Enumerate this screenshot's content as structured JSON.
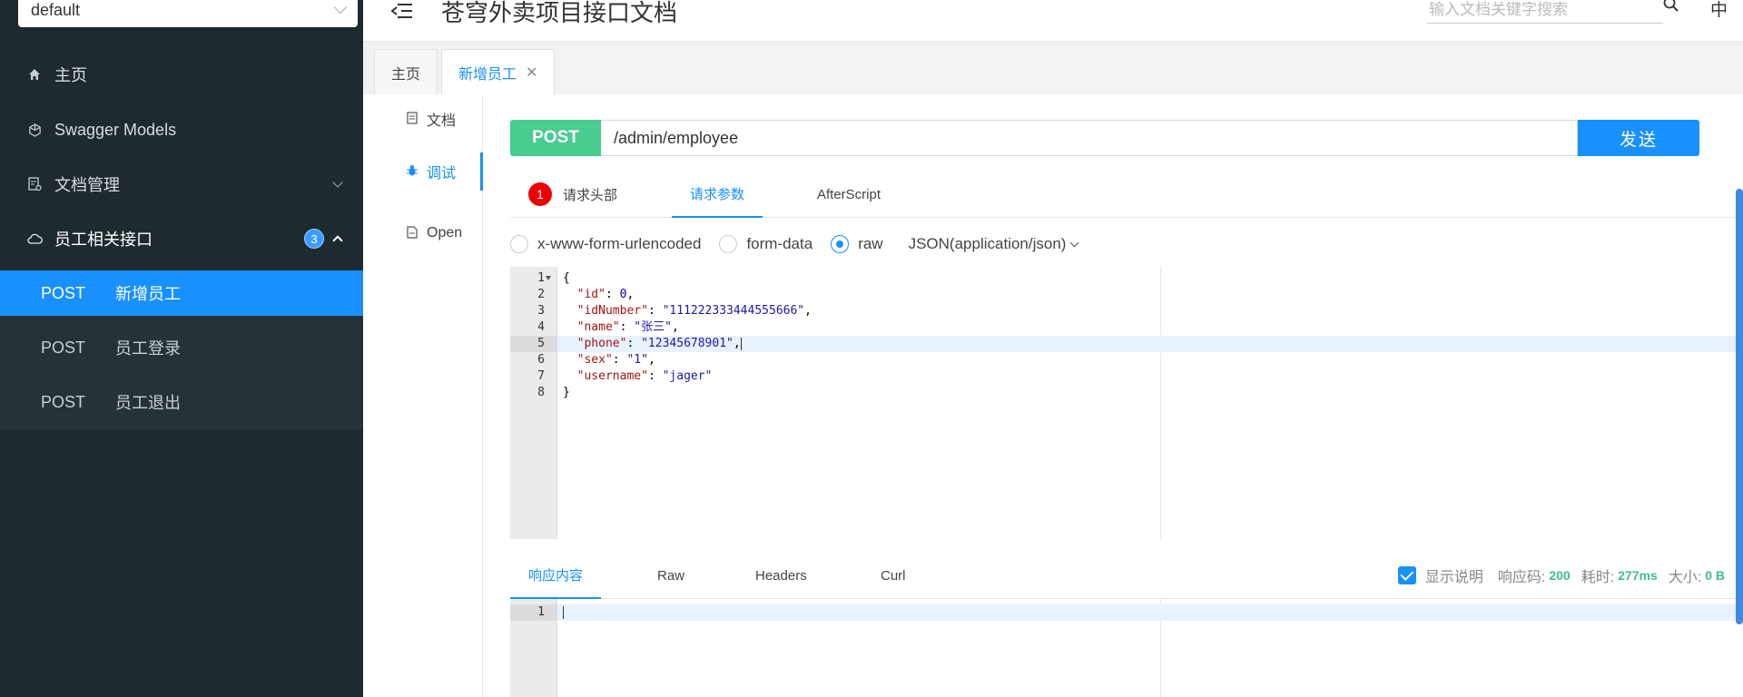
{
  "sidebar": {
    "group_select": "default",
    "items": [
      {
        "label": "主页"
      },
      {
        "label": "Swagger Models"
      },
      {
        "label": "文档管理"
      },
      {
        "label": "员工相关接口",
        "badge": "3"
      }
    ],
    "sub_items": [
      {
        "method": "POST",
        "label": "新增员工"
      },
      {
        "method": "POST",
        "label": "员工登录"
      },
      {
        "method": "POST",
        "label": "员工退出"
      }
    ]
  },
  "header": {
    "title": "苍穹外卖项目接口文档",
    "search_placeholder": "输入文档关键字搜索",
    "lang": "中"
  },
  "tabs": [
    {
      "label": "主页"
    },
    {
      "label": "新增员工"
    }
  ],
  "vnav": [
    {
      "label": "文档"
    },
    {
      "label": "调试"
    },
    {
      "label": "Open"
    }
  ],
  "request": {
    "method": "POST",
    "url": "/admin/employee",
    "send_label": "发送",
    "tabs": [
      {
        "label": "请求头部",
        "count": "1"
      },
      {
        "label": "请求参数"
      },
      {
        "label": "AfterScript"
      }
    ],
    "body_types": [
      "x-www-form-urlencoded",
      "form-data",
      "raw"
    ],
    "content_type": "JSON(application/json)",
    "body_lines": [
      "1",
      "2",
      "3",
      "4",
      "5",
      "6",
      "7",
      "8"
    ]
  },
  "body_json": {
    "id_key": "\"id\"",
    "id_val": "0",
    "idNumber_key": "\"idNumber\"",
    "idNumber_val": "\"111222333444555666\"",
    "name_key": "\"name\"",
    "name_val": "\"张三\"",
    "phone_key": "\"phone\"",
    "phone_val": "\"12345678901\"",
    "sex_key": "\"sex\"",
    "sex_val": "\"1\"",
    "username_key": "\"username\"",
    "username_val": "\"jager\""
  },
  "response": {
    "tabs": [
      {
        "label": "响应内容"
      },
      {
        "label": "Raw"
      },
      {
        "label": "Headers"
      },
      {
        "label": "Curl"
      }
    ],
    "show_desc_label": "显示说明",
    "code_label": "响应码:",
    "code_value": "200",
    "time_label": "耗时:",
    "time_value": "277ms",
    "size_label": "大小:",
    "size_value": "0 B",
    "line1": "1"
  }
}
